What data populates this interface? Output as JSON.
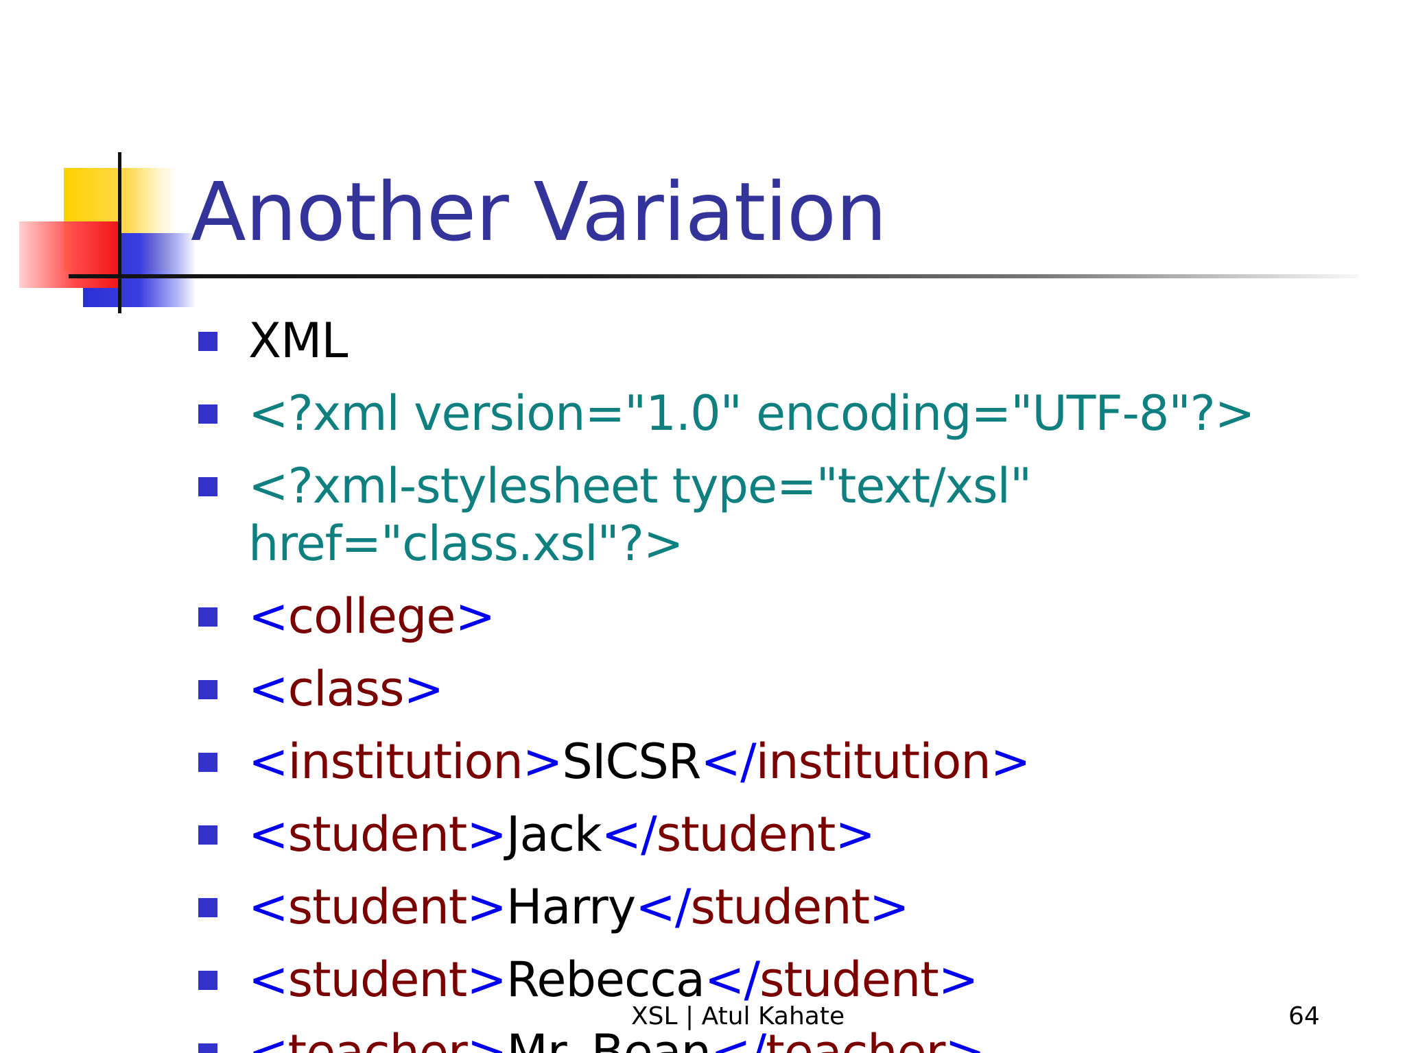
{
  "slide": {
    "title": "Another Variation",
    "items": [
      {
        "plain": "XML"
      },
      {
        "teal": "<?xml version=\"1.0\" encoding=\"UTF-8\"?>"
      },
      {
        "teal": "<?xml-stylesheet type=\"text/xsl\" href=\"class.xsl\"?>"
      },
      {
        "open_lt": "<",
        "open_name": "college",
        "open_gt": ">"
      },
      {
        "open_lt": "<",
        "open_name": "class",
        "open_gt": ">"
      },
      {
        "open_lt": "<",
        "open_name": "institution",
        "open_gt": ">",
        "text": "SICSR",
        "close_lt": "</",
        "close_name": "institution",
        "close_gt": ">"
      },
      {
        "open_lt": "<",
        "open_name": "student",
        "open_gt": ">",
        "text": "Jack",
        "close_lt": "</",
        "close_name": "student",
        "close_gt": ">"
      },
      {
        "open_lt": "<",
        "open_name": "student",
        "open_gt": ">",
        "text": "Harry",
        "close_lt": "</",
        "close_name": "student",
        "close_gt": ">"
      },
      {
        "open_lt": "<",
        "open_name": "student",
        "open_gt": ">",
        "text": "Rebecca",
        "close_lt": "</",
        "close_name": "student",
        "close_gt": ">"
      },
      {
        "open_lt": "<",
        "open_name": "teacher",
        "open_gt": ">",
        "text": "Mr. Bean",
        "close_lt": "</",
        "close_name": "teacher",
        "close_gt": ">"
      }
    ],
    "footer_text": "XSL | Atul Kahate",
    "page_number": "64"
  },
  "colors": {
    "title": "#333399",
    "bullet": "#3333cc",
    "xml_declaration": "#0f7f7f",
    "tag_brackets": "#0000ee",
    "tag_names": "#7a0000",
    "element_text": "#000000"
  },
  "icons": {
    "bullet": "square-bullet-icon",
    "logo": "overlapping-squares-logo"
  }
}
